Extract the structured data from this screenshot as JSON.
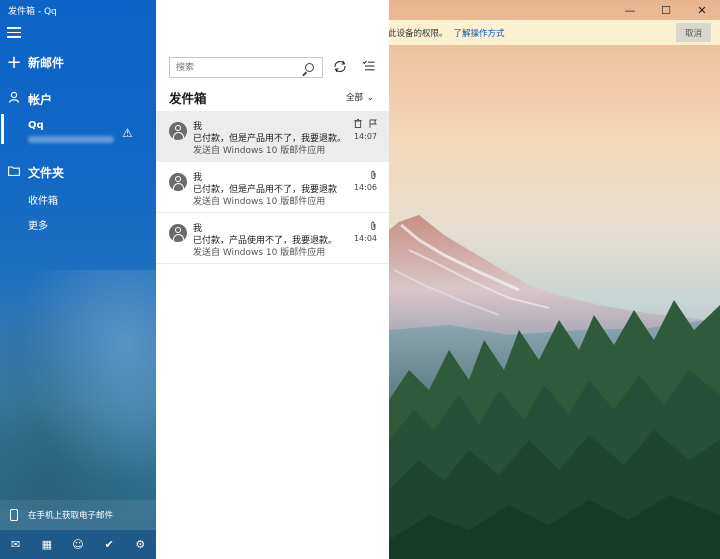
{
  "window": {
    "title": "发件箱 - Qq",
    "controls": {
      "minimize": "—",
      "maximize": "☐",
      "close": "✕"
    }
  },
  "sidebar": {
    "menu_icon": "hamburger-icon",
    "new_mail": {
      "icon": "+",
      "label": "新邮件"
    },
    "accounts": {
      "icon": "person-icon",
      "label": "帐户"
    },
    "account": {
      "name": "Qq",
      "warning_icon": "⚠"
    },
    "folders": {
      "icon": "folder-icon",
      "label": "文件夹"
    },
    "folder_items": [
      {
        "label": "收件箱"
      },
      {
        "label": "更多"
      }
    ],
    "get_mail_on_phone": "在手机上获取电子邮件",
    "bottom_nav": [
      "mail-icon",
      "calendar-icon",
      "people-icon",
      "todo-icon",
      "settings-icon"
    ]
  },
  "warning_bar": {
    "message": "无法访问此帐户: QQ。可能需要更新密码或授予帐户同步到此设备的权限。",
    "link": "了解操作方式",
    "cancel": "取消"
  },
  "message_list": {
    "search_placeholder": "搜索",
    "title": "发件箱",
    "filter": "全部",
    "messages": [
      {
        "from": "我",
        "subject": "已付款，但是产品用不了，我要退款。",
        "preview": "发送自 Windows 10 版邮件应用",
        "time": "14:07",
        "selected": true,
        "icons": [
          "delete-icon",
          "flag-icon"
        ]
      },
      {
        "from": "我",
        "subject": "已付款，但是产品用不了，我要退款",
        "preview": "发送自 Windows 10 版邮件应用",
        "time": "14:06",
        "selected": false,
        "icons": [
          "attachment-icon"
        ]
      },
      {
        "from": "我",
        "subject": "已付款，产品使用不了，我要退款。",
        "preview": "发送自 Windows 10 版邮件应用",
        "time": "14:04",
        "selected": false,
        "icons": [
          "attachment-icon"
        ]
      }
    ]
  },
  "colors": {
    "sidebar_accent": "#0d63c7",
    "warning_background": "#fbf0d0",
    "link": "#0a58b8"
  }
}
